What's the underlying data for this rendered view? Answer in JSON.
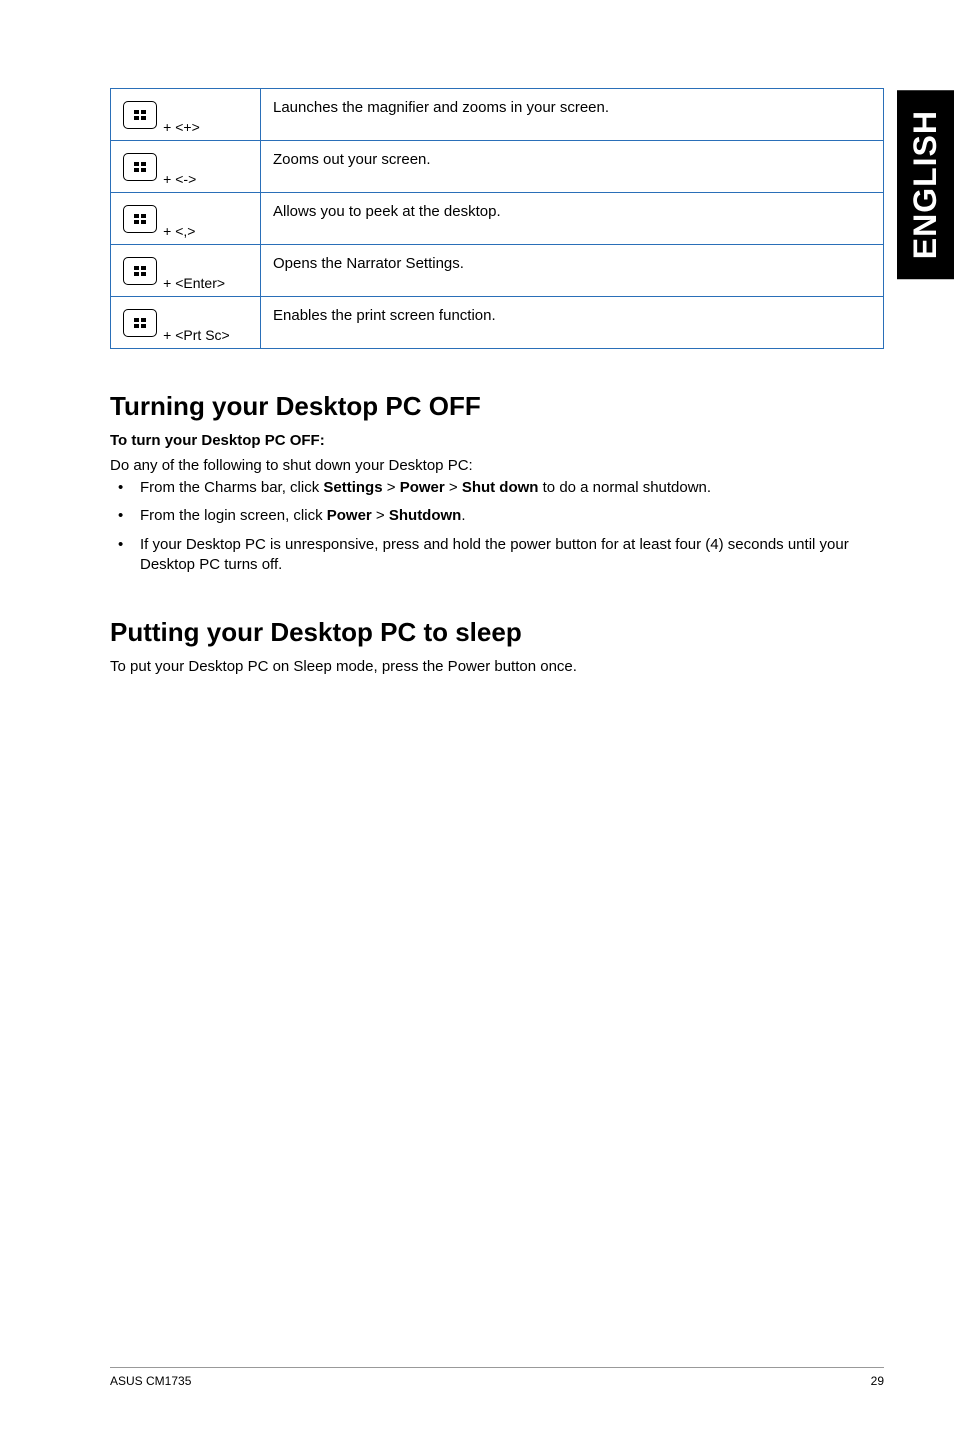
{
  "sideTab": "ENGLISH",
  "shortcuts": [
    {
      "key": "+ <+>",
      "desc": "Launches the magnifier and zooms in your screen."
    },
    {
      "key": "+ <->",
      "desc": "Zooms out your screen."
    },
    {
      "key": "+ <,>",
      "desc": "Allows you to peek at the desktop."
    },
    {
      "key": "+ <Enter>",
      "desc": "Opens the Narrator Settings."
    },
    {
      "key": "+ <Prt Sc>",
      "desc": "Enables the print screen function."
    }
  ],
  "section1": {
    "heading": "Turning your Desktop PC OFF",
    "subheading": "To turn your Desktop PC OFF:",
    "intro": "Do any of the following to shut down your Desktop PC:",
    "bullets": [
      {
        "prefix": "From the Charms bar, click ",
        "b1": "Settings",
        "sep1": " > ",
        "b2": "Power",
        "sep2": " > ",
        "b3": "Shut down",
        "suffix": " to do a normal shutdown."
      },
      {
        "prefix": "From the login screen, click ",
        "b1": "Power",
        "sep1": " > ",
        "b2": "Shutdown",
        "sep2": "",
        "b3": "",
        "suffix": "."
      },
      {
        "prefix": "If your Desktop PC is unresponsive, press and hold the power button for at least four (4) seconds until your Desktop PC turns off.",
        "b1": "",
        "sep1": "",
        "b2": "",
        "sep2": "",
        "b3": "",
        "suffix": ""
      }
    ]
  },
  "section2": {
    "heading": "Putting your Desktop PC to sleep",
    "text": "To put your Desktop PC on Sleep mode, press the Power button once."
  },
  "footer": {
    "left": "ASUS CM1735",
    "right": "29"
  }
}
